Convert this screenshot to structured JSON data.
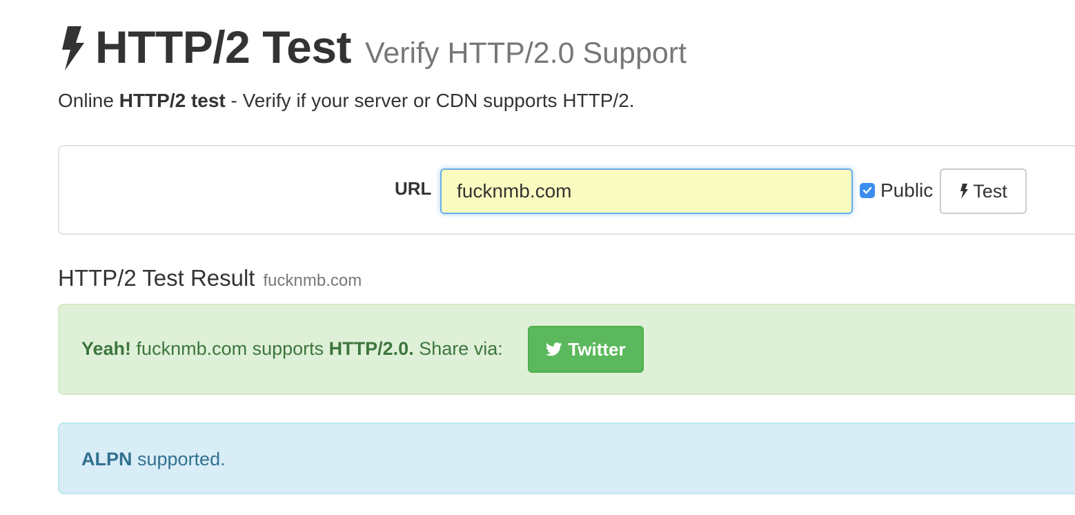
{
  "header": {
    "title": "HTTP/2 Test",
    "subtitle": "Verify HTTP/2.0 Support",
    "logo_icon": "bolt-icon"
  },
  "lead": {
    "prefix": "Online ",
    "bold": "HTTP/2 test",
    "suffix": " - Verify if your server or CDN supports HTTP/2."
  },
  "form": {
    "url_label": "URL",
    "url_value": "fucknmb.com",
    "public_label": "Public",
    "public_checked": true,
    "test_button_label": "Test",
    "test_button_icon": "bolt-icon"
  },
  "result": {
    "title": "HTTP/2 Test Result",
    "domain": "fucknmb.com"
  },
  "success_alert": {
    "yeah": "Yeah!",
    "domain_text": " fucknmb.com supports ",
    "protocol": "HTTP/2.0.",
    "share_text": " Share via:",
    "twitter_label": "Twitter",
    "twitter_icon": "twitter-bird-icon"
  },
  "info_alert": {
    "bold": "ALPN",
    "text": " supported."
  },
  "colors": {
    "success_bg": "#dff0d8",
    "success_text": "#3c763d",
    "info_bg": "#d9edf7",
    "info_text": "#31708f",
    "twitter_button": "#5cb85c",
    "input_bg": "#fafcbf",
    "input_focus_border": "#66afe9"
  }
}
